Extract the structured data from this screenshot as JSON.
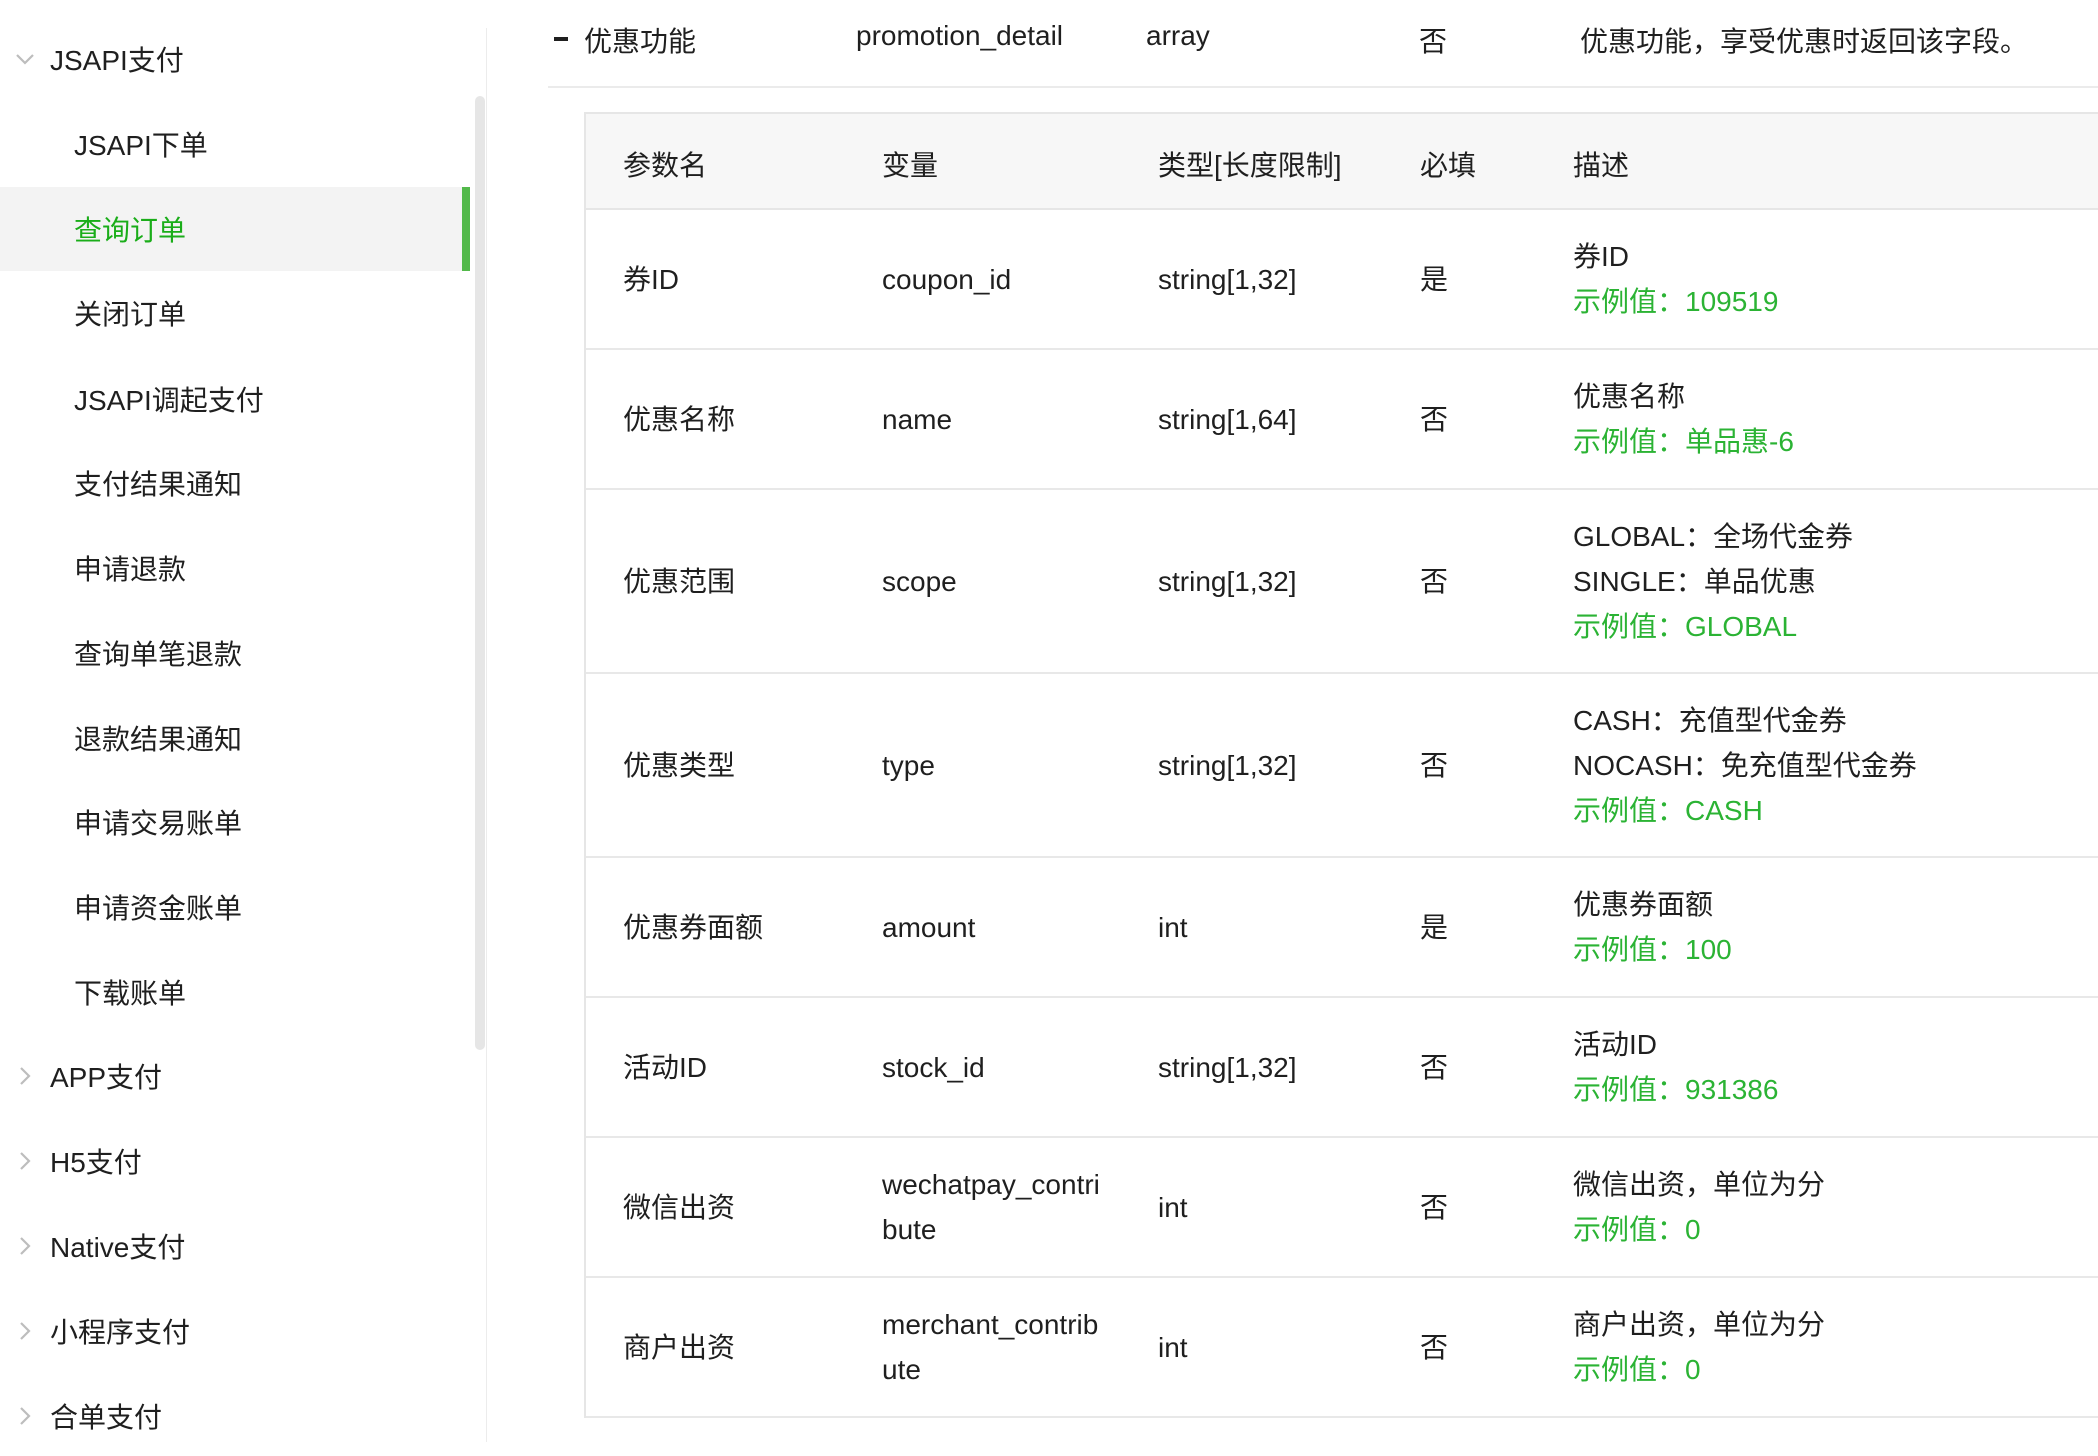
{
  "sidebar": {
    "groups": [
      {
        "label": "JSAPI支付",
        "expanded": true
      },
      {
        "label": "APP支付",
        "expanded": false
      },
      {
        "label": "H5支付",
        "expanded": false
      },
      {
        "label": "Native支付",
        "expanded": false
      },
      {
        "label": "小程序支付",
        "expanded": false
      },
      {
        "label": "合单支付",
        "expanded": false
      }
    ],
    "items": [
      {
        "label": "JSAPI下单"
      },
      {
        "label": "查询订单",
        "active": true
      },
      {
        "label": "关闭订单"
      },
      {
        "label": "JSAPI调起支付"
      },
      {
        "label": "支付结果通知"
      },
      {
        "label": "申请退款"
      },
      {
        "label": "查询单笔退款"
      },
      {
        "label": "退款结果通知"
      },
      {
        "label": "申请交易账单"
      },
      {
        "label": "申请资金账单"
      },
      {
        "label": "下载账单"
      }
    ]
  },
  "parent_row": {
    "name": "优惠功能",
    "var": "promotion_detail",
    "type": "array",
    "required": "否",
    "desc": "优惠功能，享受优惠时返回该字段。"
  },
  "table": {
    "headers": {
      "name": "参数名",
      "var": "变量",
      "type": "类型[长度限制]",
      "required": "必填",
      "desc": "描述"
    },
    "rows": [
      {
        "name": "券ID",
        "var": "coupon_id",
        "type": "string[1,32]",
        "required": "是",
        "desc": [
          "券ID"
        ],
        "example": "示例值：109519"
      },
      {
        "name": "优惠名称",
        "var": "name",
        "type": "string[1,64]",
        "required": "否",
        "desc": [
          "优惠名称"
        ],
        "example": "示例值：单品惠-6"
      },
      {
        "name": "优惠范围",
        "var": "scope",
        "type": "string[1,32]",
        "required": "否",
        "desc": [
          "GLOBAL：全场代金券",
          "SINGLE：单品优惠"
        ],
        "example": "示例值：GLOBAL"
      },
      {
        "name": "优惠类型",
        "var": "type",
        "type": "string[1,32]",
        "required": "否",
        "desc": [
          "CASH：充值型代金券",
          "NOCASH：免充值型代金券"
        ],
        "example": "示例值：CASH"
      },
      {
        "name": "优惠券面额",
        "var": "amount",
        "type": "int",
        "required": "是",
        "desc": [
          "优惠券面额"
        ],
        "example": "示例值：100"
      },
      {
        "name": "活动ID",
        "var": "stock_id",
        "type": "string[1,32]",
        "required": "否",
        "desc": [
          "活动ID"
        ],
        "example": "示例值：931386"
      },
      {
        "name": "微信出资",
        "var": "wechatpay_contribute",
        "type": "int",
        "required": "否",
        "desc": [
          "微信出资，单位为分"
        ],
        "example": "示例值：0"
      },
      {
        "name": "商户出资",
        "var": "merchant_contribute",
        "type": "int",
        "required": "否",
        "desc": [
          "商户出资，单位为分"
        ],
        "example": "示例值：0"
      }
    ]
  },
  "colors": {
    "accent": "#1aad19",
    "example_text": "#2bb334",
    "active_bar": "#52b94a"
  }
}
